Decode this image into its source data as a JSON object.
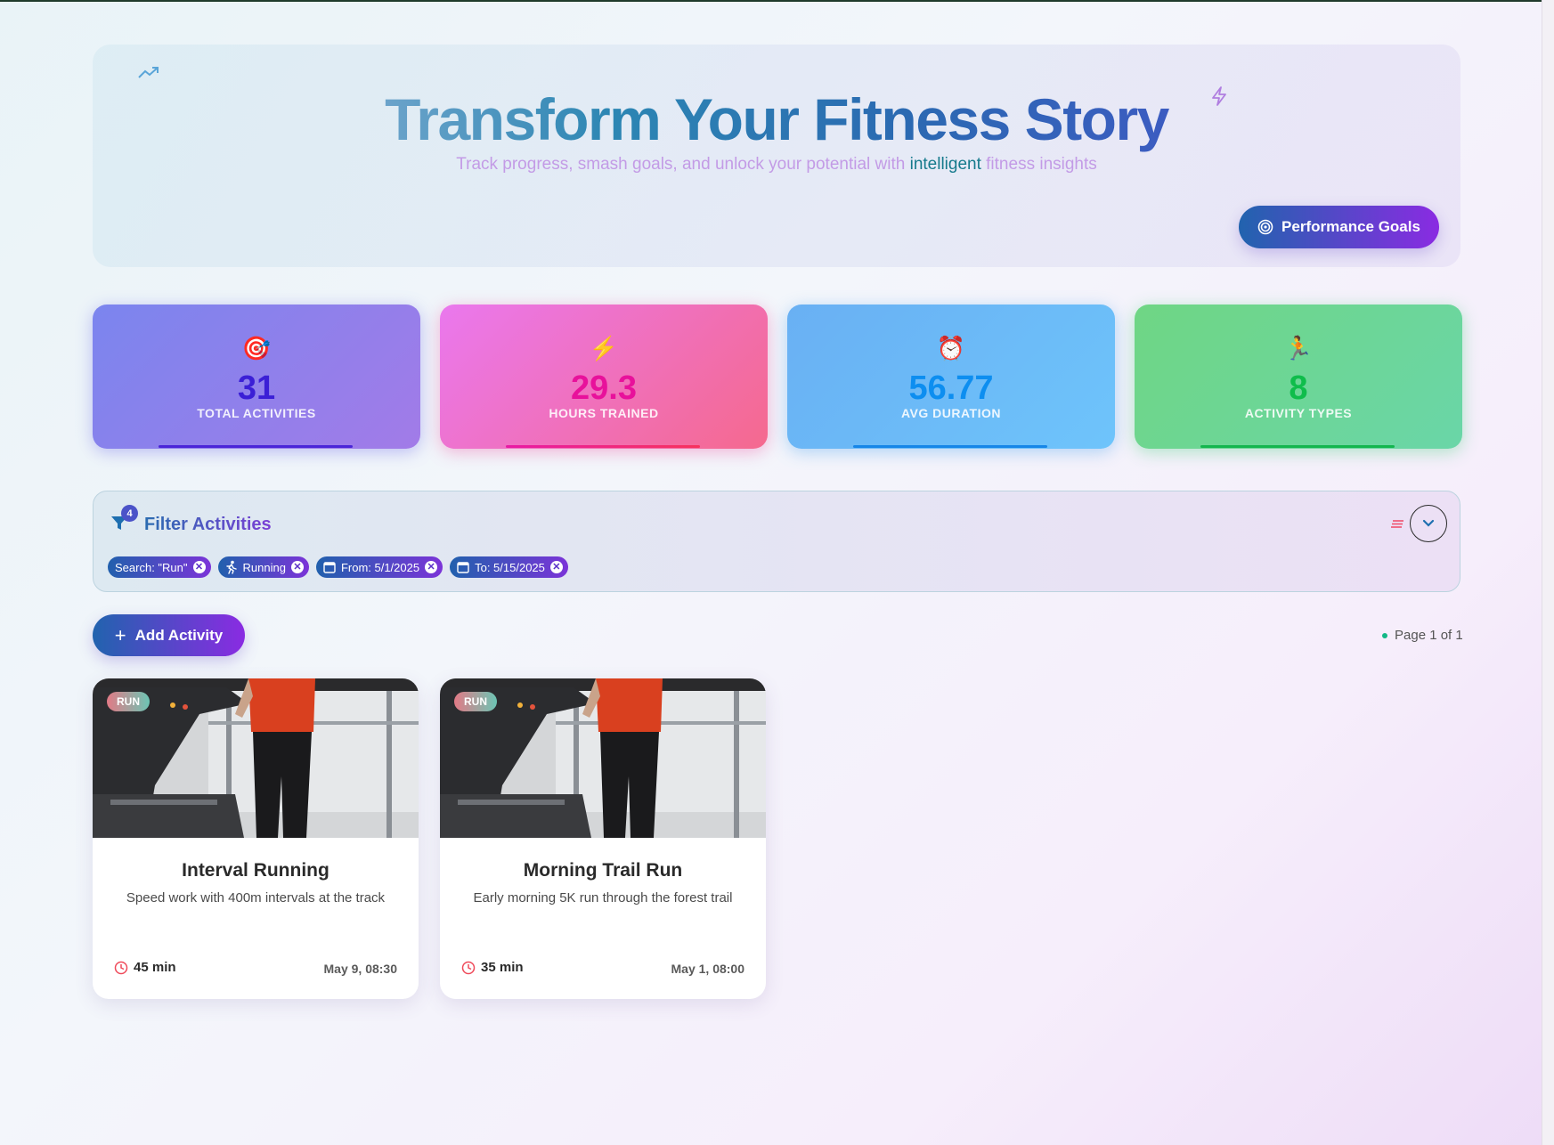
{
  "hero": {
    "title": "Transform Your Fitness Story",
    "subtitle_before": "Track progress, smash goals, and unlock your potential with ",
    "subtitle_highlight": "intelligent",
    "subtitle_after": " fitness insights",
    "goals_button": "Performance Goals"
  },
  "stats": [
    {
      "icon": "🎯",
      "icon_name": "target-icon",
      "value": "31",
      "label": "TOTAL ACTIVITIES"
    },
    {
      "icon": "⚡",
      "icon_name": "lightning-icon",
      "value": "29.3",
      "label": "HOURS TRAINED"
    },
    {
      "icon": "⏰",
      "icon_name": "alarm-clock-icon",
      "value": "56.77",
      "label": "AVG DURATION"
    },
    {
      "icon": "🏃",
      "icon_name": "runner-icon",
      "value": "8",
      "label": "ACTIVITY TYPES"
    }
  ],
  "filter": {
    "title": "Filter Activities",
    "count": "4",
    "chips": [
      {
        "label": "Search: \"Run\"",
        "icon": "none"
      },
      {
        "label": "Running",
        "icon": "running-icon"
      },
      {
        "label": "From: 5/1/2025",
        "icon": "calendar-icon"
      },
      {
        "label": "To: 5/15/2025",
        "icon": "calendar-icon"
      }
    ]
  },
  "actions": {
    "add_activity": "Add Activity",
    "page_info": "Page 1 of 1"
  },
  "activities": [
    {
      "tag": "RUN",
      "title": "Interval Running",
      "description": "Speed work with 400m intervals at the track",
      "duration": "45 min",
      "date": "May 9, 08:30"
    },
    {
      "tag": "RUN",
      "title": "Morning Trail Run",
      "description": "Early morning 5K run through the forest trail",
      "duration": "35 min",
      "date": "May 1, 08:00"
    }
  ],
  "colors": {
    "accent_start": "#2163ae",
    "accent_end": "#8a2be2",
    "status_dot": "#12b886"
  }
}
